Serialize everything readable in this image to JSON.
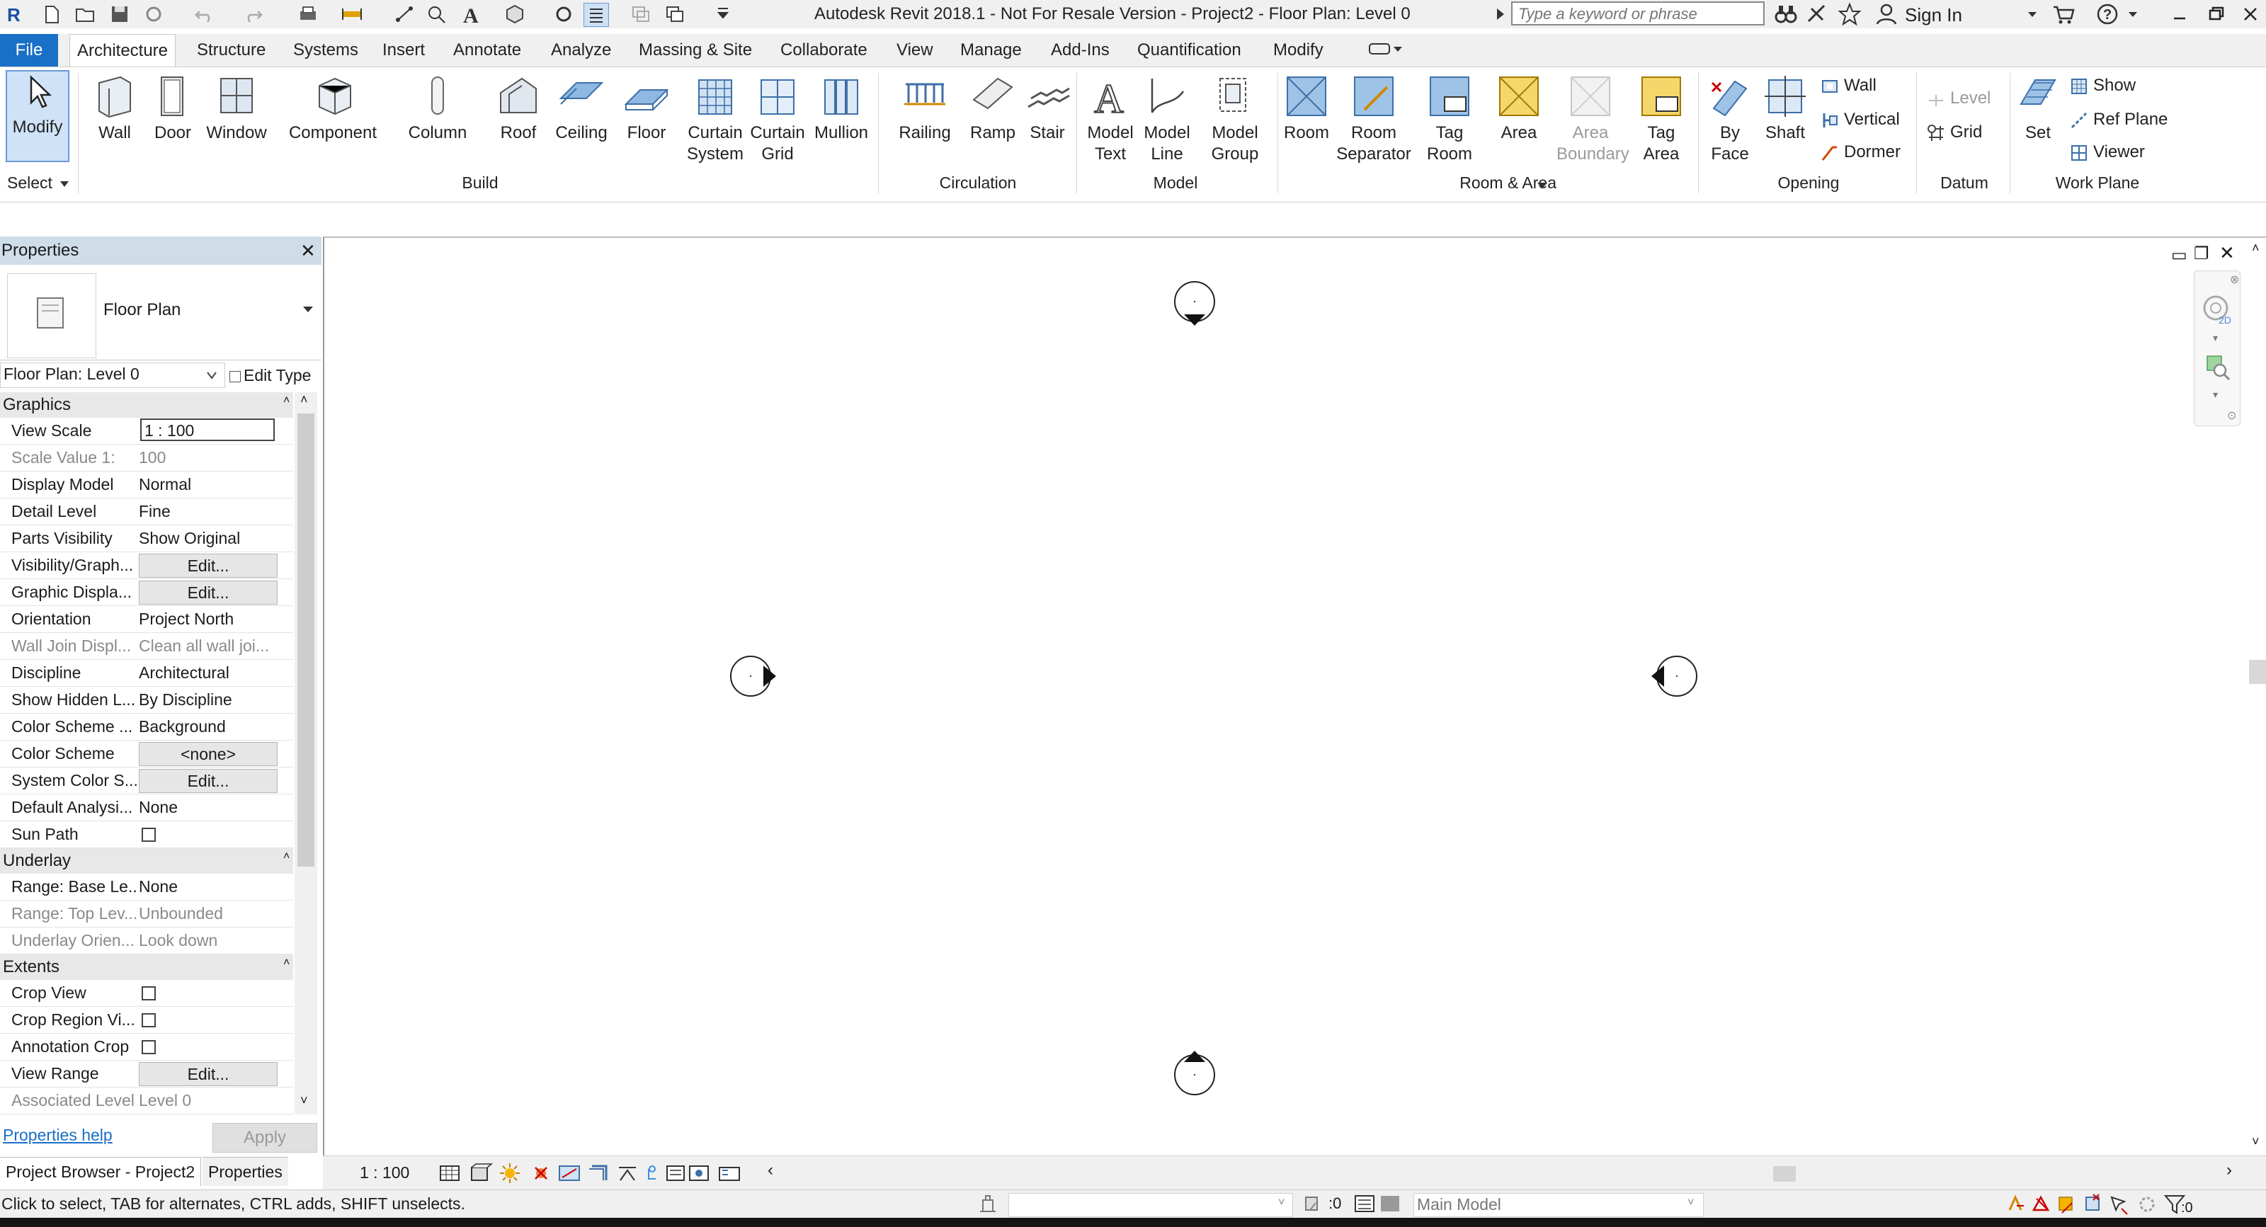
{
  "app": {
    "title": "Autodesk Revit 2018.1 - Not For Resale Version -     Project2 - Floor Plan: Level 0",
    "search_placeholder": "Type a keyword or phrase",
    "sign_in": "Sign In"
  },
  "tabs": [
    "File",
    "Architecture",
    "Structure",
    "Systems",
    "Insert",
    "Annotate",
    "Analyze",
    "Massing & Site",
    "Collaborate",
    "View",
    "Manage",
    "Add-Ins",
    "Quantification",
    "Modify"
  ],
  "ribbon": {
    "select": {
      "modify": "Modify",
      "panel": "Select"
    },
    "build": {
      "panel": "Build",
      "tools": [
        {
          "l1": "Wall",
          "l2": ""
        },
        {
          "l1": "Door",
          "l2": ""
        },
        {
          "l1": "Window",
          "l2": ""
        },
        {
          "l1": "Component",
          "l2": ""
        },
        {
          "l1": "Column",
          "l2": ""
        },
        {
          "l1": "Roof",
          "l2": ""
        },
        {
          "l1": "Ceiling",
          "l2": ""
        },
        {
          "l1": "Floor",
          "l2": ""
        },
        {
          "l1": "Curtain",
          "l2": "System"
        },
        {
          "l1": "Curtain",
          "l2": "Grid"
        },
        {
          "l1": "Mullion",
          "l2": ""
        }
      ]
    },
    "circulation": {
      "panel": "Circulation",
      "tools": [
        {
          "l1": "Railing"
        },
        {
          "l1": "Ramp"
        },
        {
          "l1": "Stair"
        }
      ]
    },
    "model": {
      "panel": "Model",
      "tools": [
        {
          "l1": "Model",
          "l2": "Text"
        },
        {
          "l1": "Model",
          "l2": "Line"
        },
        {
          "l1": "Model",
          "l2": "Group"
        }
      ]
    },
    "room_area": {
      "panel": "Room & Area",
      "tools": [
        {
          "l1": "Room",
          "l2": ""
        },
        {
          "l1": "Room",
          "l2": "Separator"
        },
        {
          "l1": "Tag",
          "l2": "Room"
        },
        {
          "l1": "Area",
          "l2": ""
        },
        {
          "l1": "Area",
          "l2": "Boundary"
        },
        {
          "l1": "Tag",
          "l2": "Area"
        }
      ]
    },
    "opening": {
      "panel": "Opening",
      "tools": [
        {
          "l1": "By",
          "l2": "Face"
        },
        {
          "l1": "Shaft",
          "l2": ""
        }
      ],
      "small": [
        "Wall",
        "Vertical",
        "Dormer"
      ]
    },
    "datum": {
      "panel": "Datum",
      "small": [
        "Level",
        "Grid"
      ]
    },
    "work_plane": {
      "panel": "Work Plane",
      "set": "Set",
      "small": [
        "Show",
        "Ref  Plane",
        "Viewer"
      ]
    }
  },
  "properties": {
    "title": "Properties",
    "type_name": "Floor Plan",
    "instance": "Floor Plan: Level 0",
    "edit_type": "Edit Type",
    "groups": {
      "graphics": "Graphics",
      "underlay": "Underlay",
      "extents": "Extents"
    },
    "graphics_rows": [
      {
        "name": "View Scale",
        "value": "1 : 100"
      },
      {
        "name": "Scale Value    1:",
        "value": "100"
      },
      {
        "name": "Display Model",
        "value": "Normal"
      },
      {
        "name": "Detail Level",
        "value": "Fine"
      },
      {
        "name": "Parts Visibility",
        "value": "Show Original"
      },
      {
        "name": "Visibility/Graph...",
        "value": "Edit..."
      },
      {
        "name": "Graphic Displa...",
        "value": "Edit..."
      },
      {
        "name": "Orientation",
        "value": "Project North"
      },
      {
        "name": "Wall Join Displ...",
        "value": "Clean all wall joi..."
      },
      {
        "name": "Discipline",
        "value": "Architectural"
      },
      {
        "name": "Show Hidden L...",
        "value": "By Discipline"
      },
      {
        "name": "Color Scheme ...",
        "value": "Background"
      },
      {
        "name": "Color Scheme",
        "value": "<none>"
      },
      {
        "name": "System Color S...",
        "value": "Edit..."
      },
      {
        "name": "Default Analysi...",
        "value": "None"
      },
      {
        "name": "Sun Path",
        "value": ""
      }
    ],
    "underlay_rows": [
      {
        "name": "Range: Base Le...",
        "value": "None"
      },
      {
        "name": "Range: Top Lev...",
        "value": "Unbounded"
      },
      {
        "name": "Underlay Orien...",
        "value": "Look down"
      }
    ],
    "extents_rows": [
      {
        "name": "Crop View",
        "value": ""
      },
      {
        "name": "Crop Region Vi...",
        "value": ""
      },
      {
        "name": "Annotation Crop",
        "value": ""
      },
      {
        "name": "View Range",
        "value": "Edit..."
      },
      {
        "name": "Associated Level",
        "value": "Level 0"
      }
    ],
    "help": "Properties help",
    "apply": "Apply"
  },
  "bottom_tabs": [
    "Project Browser - Project2",
    "Properties"
  ],
  "view_bar": {
    "scale": "1 : 100"
  },
  "status": {
    "message": "Click to select, TAB for alternates, CTRL adds, SHIFT unselects.",
    "workset_value": ":0",
    "model": "Main Model",
    "filter_count": ":0"
  },
  "colors": {
    "file_tab": "#1a6fc6",
    "panel_header": "#cfdde9",
    "accent": "#3b7bd4"
  }
}
